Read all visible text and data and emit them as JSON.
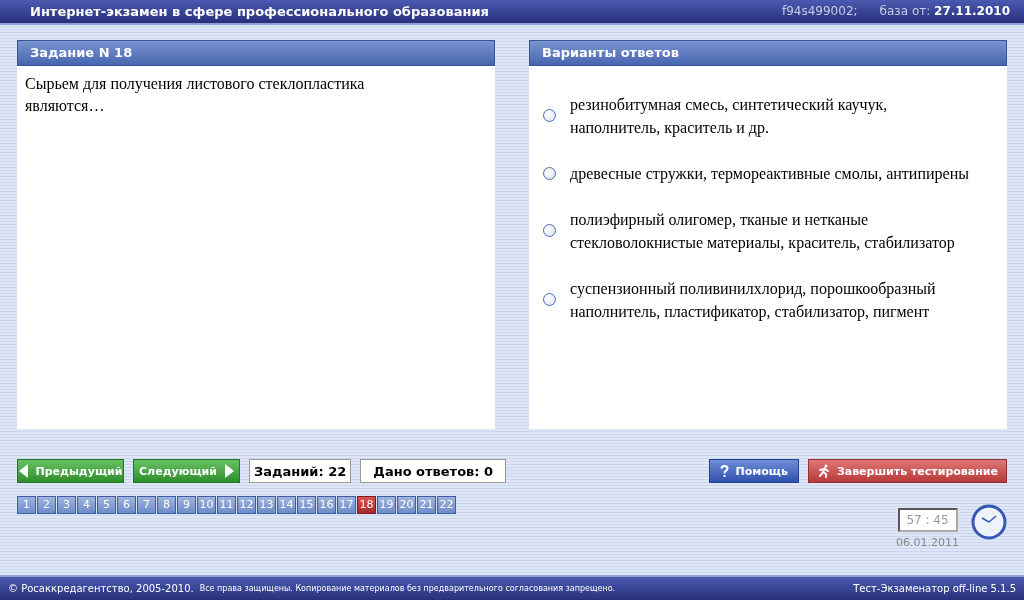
{
  "header": {
    "title": "Интернет-экзамен в сфере профессионального образования",
    "code": "f94s499002;",
    "base_date": "база от: **27.11.2010**"
  },
  "task": {
    "title": "Задание N 18",
    "question": "Сырьем для получения листового стеклопластика являются…"
  },
  "answers": {
    "title": "Варианты ответов",
    "options": [
      {
        "text": "резинобитумная смесь, синтетический каучук, наполнитель, краситель и др.",
        "selected": false
      },
      {
        "text": "древесные стружки, термореактивные смолы, антипирены",
        "selected": false
      },
      {
        "text": "полиэфирный олигомер, тканые и нетканые стекловолокнистые материалы, краситель, стабилизатор",
        "selected": false
      },
      {
        "text": "суспензионный поливинилхлорид, порошкообразный наполнитель, пластификатор, стабилизатор, пигмент",
        "selected": false
      }
    ]
  },
  "toolbar": {
    "prev": "Предыдущий",
    "next": "Следующий",
    "tasks_count": "Заданий: 22",
    "answered": "Дано ответов: 0",
    "help": "Помощь",
    "finish": "Завершить тестирование"
  },
  "pages": [
    {
      "label": "1",
      "selected": false
    },
    {
      "label": "2",
      "selected": false
    },
    {
      "label": "3",
      "selected": false
    },
    {
      "label": "4",
      "selected": false
    },
    {
      "label": "5",
      "selected": false
    },
    {
      "label": "6",
      "selected": false
    },
    {
      "label": "7",
      "selected": false
    },
    {
      "label": "8",
      "selected": false
    },
    {
      "label": "9",
      "selected": false
    },
    {
      "label": "10",
      "selected": false
    },
    {
      "label": "11",
      "selected": false
    },
    {
      "label": "12",
      "selected": false
    },
    {
      "label": "13",
      "selected": false
    },
    {
      "label": "14",
      "selected": false
    },
    {
      "label": "15",
      "selected": false
    },
    {
      "label": "16",
      "selected": false
    },
    {
      "label": "17",
      "selected": false
    },
    {
      "label": "18",
      "selected": true
    },
    {
      "label": "19",
      "selected": false
    },
    {
      "label": "20",
      "selected": false
    },
    {
      "label": "21",
      "selected": false
    },
    {
      "label": "22",
      "selected": false
    }
  ],
  "timer": {
    "time": "57 : 45",
    "date": "06.01.2011"
  },
  "footer": {
    "copyright": "© Росаккредагентство, 2005-2010.",
    "notice": "Все права защищены. Копирование материалов без предварительного согласования запрещено.",
    "version": "Тест-Экзаменатор off-line 5.1.5"
  }
}
